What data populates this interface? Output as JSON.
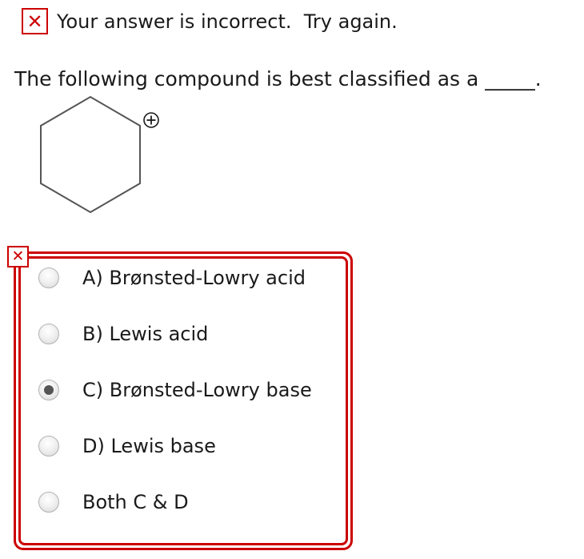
{
  "feedback": {
    "text": "Your answer is incorrect.  Try again.",
    "status_color": "#cc0000",
    "icon": "x-icon"
  },
  "question": {
    "text": "The following compound is best classified as a _____.",
    "molecule_icon": "cyclohexyl-cation-structure",
    "charge_label": "+"
  },
  "answers": {
    "status_icon": "x-icon",
    "options": [
      {
        "label": "A) Brønsted-Lowry acid",
        "selected": false
      },
      {
        "label": "B) Lewis acid",
        "selected": false
      },
      {
        "label": "C) Brønsted-Lowry base",
        "selected": true
      },
      {
        "label": "D) Lewis base",
        "selected": false
      },
      {
        "label": "Both C & D",
        "selected": false
      }
    ]
  }
}
